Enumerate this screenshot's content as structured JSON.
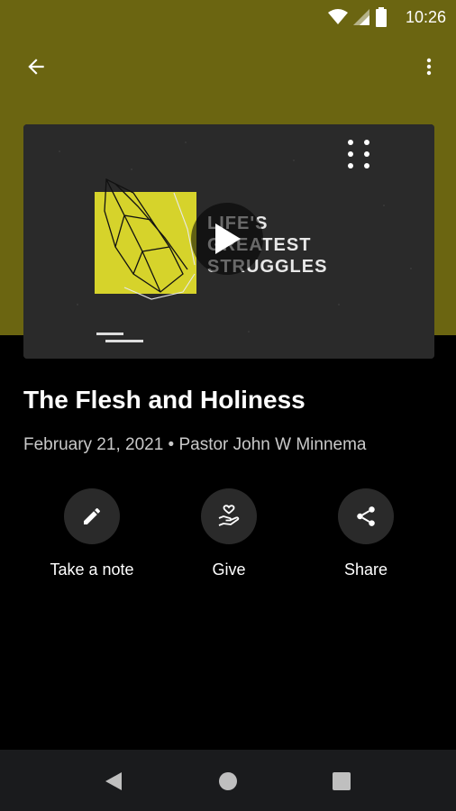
{
  "status_bar": {
    "time": "10:26"
  },
  "colors": {
    "header_background": "#6b6511",
    "accent_yellow": "#d6d32b",
    "background": "#000000",
    "nav_bar": "#1a1b1d"
  },
  "toolbar": {
    "back_icon": "arrow-left-icon",
    "more_icon": "more-vertical-icon"
  },
  "media": {
    "artwork_lines": [
      "LIFE'S",
      "GREATEST",
      "STRUGGLES"
    ],
    "play_icon": "play-icon"
  },
  "sermon": {
    "title": "The Flesh and Holiness",
    "meta": "February 21, 2021 • Pastor John W Minnema"
  },
  "actions": [
    {
      "label": "Take a note",
      "icon": "pencil-icon"
    },
    {
      "label": "Give",
      "icon": "giving-hand-icon"
    },
    {
      "label": "Share",
      "icon": "share-icon"
    }
  ],
  "navigation": {
    "back": "back-triangle-icon",
    "home": "home-circle-icon",
    "recents": "recents-square-icon"
  }
}
